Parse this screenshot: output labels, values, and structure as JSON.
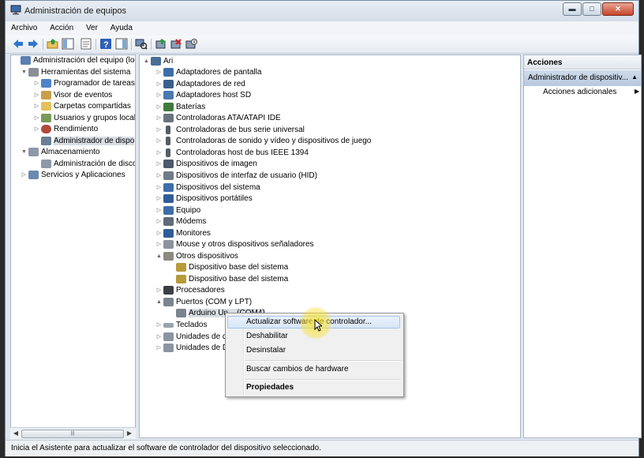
{
  "window": {
    "title": "Administración de equipos",
    "buttons": {
      "minimize": "▬",
      "maximize": "□",
      "close": "✕"
    }
  },
  "menu": [
    "Archivo",
    "Acción",
    "Ver",
    "Ayuda"
  ],
  "toolbar": [
    "back-icon",
    "forward-icon",
    "up-folder-icon",
    "show-hide-tree-icon",
    "properties-icon",
    "help-icon",
    "show-action-pane-icon",
    "scan-hardware-icon",
    "update-driver-icon",
    "uninstall-icon",
    "disable-icon"
  ],
  "left_tree": [
    {
      "label": "Administración del equipo (loc",
      "expander": ""
    },
    {
      "label": "Herramientas del sistema",
      "expander": "▼"
    },
    {
      "label": "Programador de tareas",
      "expander": "▷"
    },
    {
      "label": "Visor de eventos",
      "expander": "▷"
    },
    {
      "label": "Carpetas compartidas",
      "expander": "▷"
    },
    {
      "label": "Usuarios y grupos locale",
      "expander": "▷"
    },
    {
      "label": "Rendimiento",
      "expander": "▷"
    },
    {
      "label": "Administrador de dispo",
      "expander": ""
    },
    {
      "label": "Almacenamiento",
      "expander": "▼"
    },
    {
      "label": "Administración de disco",
      "expander": ""
    },
    {
      "label": "Servicios y Aplicaciones",
      "expander": "▷"
    }
  ],
  "device_tree": [
    {
      "label": "Ari",
      "expander": "▲"
    },
    {
      "label": "Adaptadores de pantalla",
      "expander": "▷"
    },
    {
      "label": "Adaptadores de red",
      "expander": "▷"
    },
    {
      "label": "Adaptadores host SD",
      "expander": "▷"
    },
    {
      "label": "Baterías",
      "expander": "▷"
    },
    {
      "label": "Controladoras ATA/ATAPI IDE",
      "expander": "▷"
    },
    {
      "label": "Controladoras de bus serie universal",
      "expander": "▷"
    },
    {
      "label": "Controladoras de sonido y vídeo y dispositivos de juego",
      "expander": "▷"
    },
    {
      "label": "Controladoras host de bus IEEE 1394",
      "expander": "▷"
    },
    {
      "label": "Dispositivos de imagen",
      "expander": "▷"
    },
    {
      "label": "Dispositivos de interfaz de usuario (HID)",
      "expander": "▷"
    },
    {
      "label": "Dispositivos del sistema",
      "expander": "▷"
    },
    {
      "label": "Dispositivos portátiles",
      "expander": "▷"
    },
    {
      "label": "Equipo",
      "expander": "▷"
    },
    {
      "label": "Módems",
      "expander": "▷"
    },
    {
      "label": "Monitores",
      "expander": "▷"
    },
    {
      "label": "Mouse y otros dispositivos señaladores",
      "expander": "▷"
    },
    {
      "label": "Otros dispositivos",
      "expander": "▲"
    },
    {
      "label": "Dispositivo base del sistema",
      "expander": ""
    },
    {
      "label": "Dispositivo base del sistema",
      "expander": ""
    },
    {
      "label": "Procesadores",
      "expander": "▷"
    },
    {
      "label": "Puertos (COM y LPT)",
      "expander": "▲"
    },
    {
      "label": "Arduino Un... (COM4)",
      "expander": ""
    },
    {
      "label": "Teclados",
      "expander": "▷"
    },
    {
      "label": "Unidades de di",
      "expander": "▷"
    },
    {
      "label": "Unidades de DV",
      "expander": "▷"
    }
  ],
  "actions": {
    "header": "Acciones",
    "section": "Administrador de dispositiv...",
    "section_caret": "▲",
    "items": [
      {
        "label": "Acciones adicionales",
        "caret": "▶"
      }
    ]
  },
  "context_menu": [
    "Actualizar software de controlador...",
    "Deshabilitar",
    "Desinstalar",
    "Buscar cambios de hardware",
    "Propiedades"
  ],
  "status_bar": "Inicia el Asistente para actualizar el software de controlador del dispositivo seleccionado.",
  "scrollbar": {
    "left_arrow": "◀",
    "right_arrow": "▶",
    "grip": "|||"
  }
}
